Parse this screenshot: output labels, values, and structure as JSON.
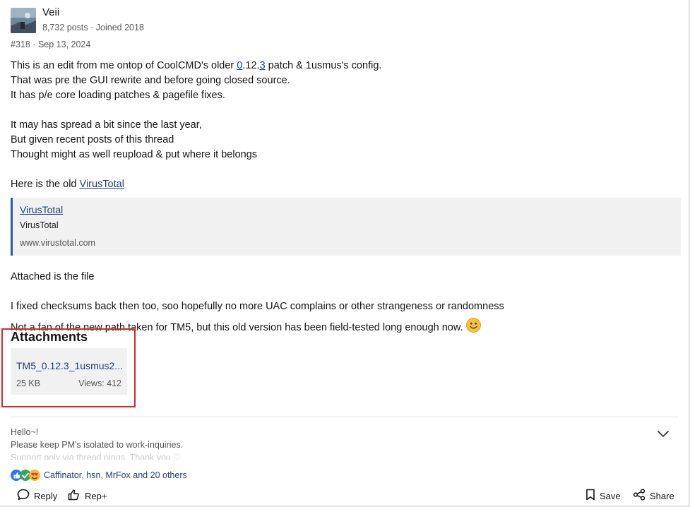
{
  "author": {
    "name": "Veii",
    "posts": "8,732 posts",
    "separator": "·",
    "joined": "Joined 2018"
  },
  "post": {
    "number": "#318",
    "separator": "·",
    "date": "Sep 13, 2024"
  },
  "body": {
    "line1_pre": "This is an edit from me ontop of CoolCMD's older ",
    "line1_link_a": "0",
    "line1_mid": ".12.",
    "line1_link_b": "3",
    "line1_post": " patch & 1usmus's config.",
    "line2": "That was pre the GUI rewrite and before going closed source.",
    "line3": "It has p/e core loading patches & pagefile fixes.",
    "line4": "It may has spread a bit since the last year,",
    "line5": "But given recent posts of this thread",
    "line6": "Thought might as well reupload & put where it belongs",
    "line7_pre": "Here is the old ",
    "line7_link": "VirusTotal",
    "line8": "Attached is the file",
    "line9": "I fixed checksums back then too, soo hopefully no more UAC complains or other strangeness or randomness",
    "line10": "Not a fan of the new path taken for TM5, but this old version has been field-tested long enough now."
  },
  "quote": {
    "link": "VirusTotal",
    "title": "VirusTotal",
    "url": "www.virustotal.com"
  },
  "attachments": {
    "heading": "Attachments",
    "file_name": "TM5_0.12.3_1usmus2...",
    "size": "25 KB",
    "views": "Views: 412"
  },
  "signature": {
    "line1": "Hello~!",
    "line2": "Please keep PM's isolated to work-inquiries.",
    "line3": "Support only via thread pings. Thank you ♡"
  },
  "reactions": {
    "icons": [
      "like-icon",
      "thumbs-up-icon",
      "love-icon"
    ],
    "users": [
      "Caffinator",
      "hsn",
      "MrFox"
    ],
    "separator": ",",
    "conjunction": "and",
    "others": "20 others"
  },
  "actions": {
    "reply": "Reply",
    "rep": "Rep+",
    "save": "Save",
    "share": "Share"
  },
  "colors": {
    "link": "#1f3f77",
    "quote_border": "#2f5a96",
    "highlight": "#d42a2a"
  }
}
